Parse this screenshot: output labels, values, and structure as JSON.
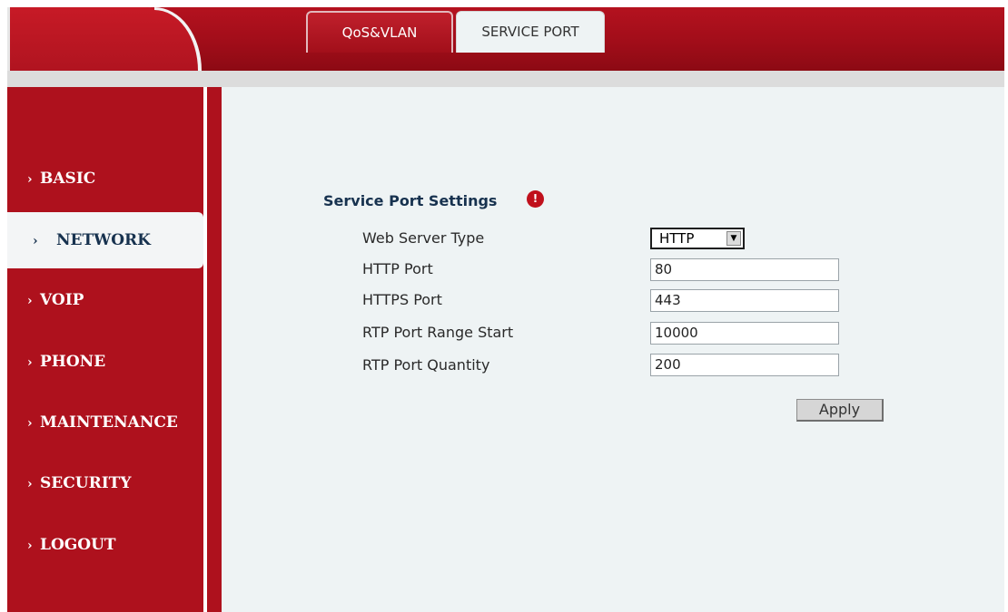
{
  "header": {
    "tabs": [
      {
        "label": "QoS&VLAN",
        "active": true
      },
      {
        "label": "SERVICE PORT",
        "active": false
      }
    ]
  },
  "sidebar": {
    "items": [
      {
        "label": "BASIC",
        "active": false
      },
      {
        "label": "NETWORK",
        "active": true
      },
      {
        "label": "VOIP",
        "active": false
      },
      {
        "label": "PHONE",
        "active": false
      },
      {
        "label": "MAINTENANCE",
        "active": false
      },
      {
        "label": "SECURITY",
        "active": false
      },
      {
        "label": "LOGOUT",
        "active": false
      }
    ],
    "chevron": "›"
  },
  "main": {
    "section_title": "Service Port Settings",
    "help_icon": "!",
    "fields": {
      "web_server_type": {
        "label": "Web Server Type",
        "value": "HTTP"
      },
      "http_port": {
        "label": "HTTP Port",
        "value": "80"
      },
      "https_port": {
        "label": "HTTPS Port",
        "value": "443"
      },
      "rtp_start": {
        "label": "RTP Port Range Start",
        "value": "10000"
      },
      "rtp_quantity": {
        "label": "RTP Port Quantity",
        "value": "200"
      }
    },
    "apply_label": "Apply"
  },
  "colors": {
    "brand_red": "#ae111d",
    "content_bg": "#eef3f4",
    "title_navy": "#17324f"
  }
}
